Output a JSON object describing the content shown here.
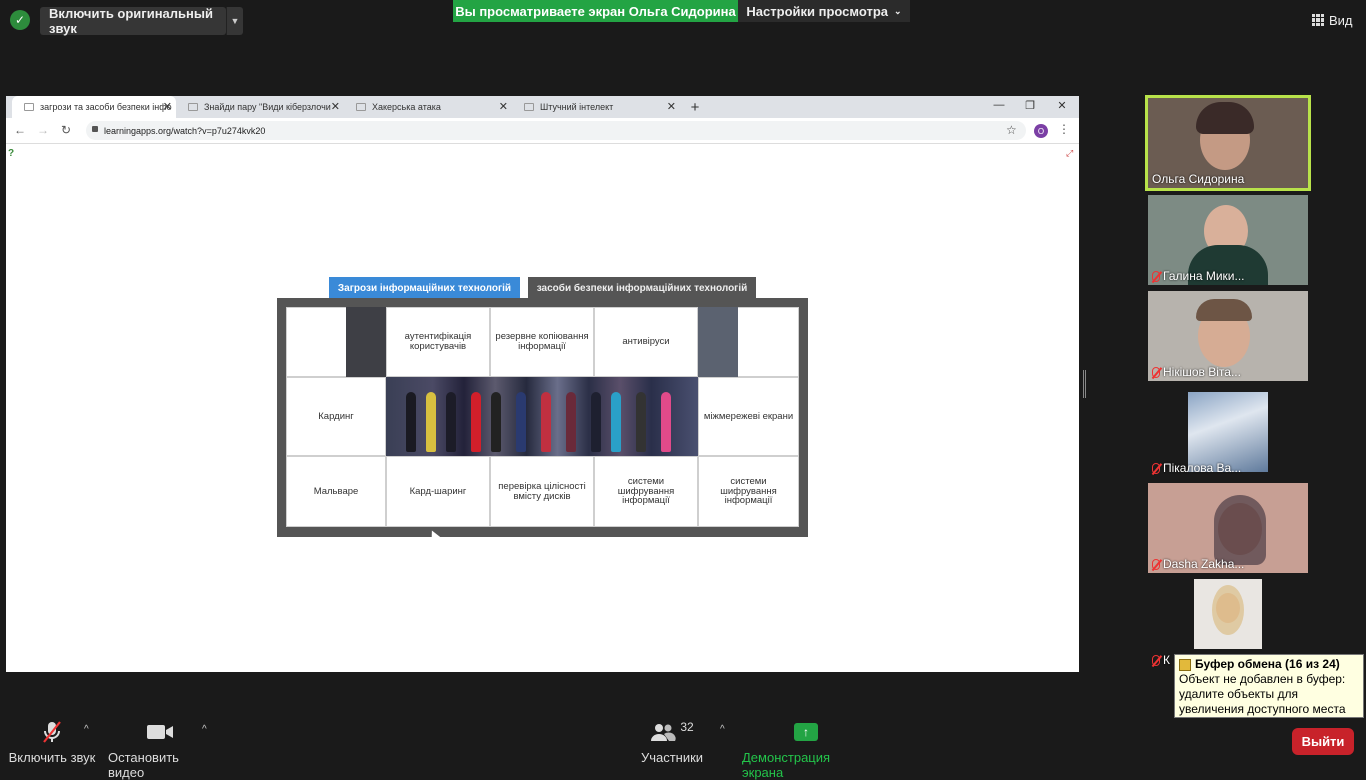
{
  "topbar": {
    "original_sound": "Включить оригинальный звук",
    "viewing_banner": "Вы просматриваете экран Ольга Сидорина",
    "view_settings": "Настройки просмотра",
    "view_button": "Вид"
  },
  "browser": {
    "tabs": [
      {
        "title": "загрози та засоби безпеки інфо"
      },
      {
        "title": "Знайди пару \"Види кіберзлочи"
      },
      {
        "title": "Хакерська атака"
      },
      {
        "title": "Штучний інтелект"
      }
    ],
    "url": "learningapps.org/watch?v=p7u274kvk20",
    "profile_initial": "O"
  },
  "puzzle": {
    "tab_active": "Загрози інформаційних технологій",
    "tab_inactive": "засоби безпеки інформаційних технологій",
    "pieces": {
      "r1c2": "аутентифікація користувачів",
      "r1c3": "резервне копіювання інформації",
      "r1c4": "антивіруси",
      "r2c1": "Кардинг",
      "r2c5": "міжмережеві екрани",
      "r3c1": "Мальваре",
      "r3c2": "Кард-шаринг",
      "r3c3": "перевірка цілісності вмісту дисків",
      "r3c4": "системи шифрування інформації",
      "r3c5": "системи шифрування інформації"
    }
  },
  "participants": [
    {
      "name": "Ольга Сидорина"
    },
    {
      "name": "Галина Мики..."
    },
    {
      "name": "Нікішов Віта..."
    },
    {
      "name": "Пікалова Ва..."
    },
    {
      "name": "Dasha Zakha..."
    },
    {
      "name": "К"
    }
  ],
  "clipboard": {
    "title": "Буфер обмена (16 из 24)",
    "message": "Объект не добавлен в буфер: удалите объекты для увеличения доступного места"
  },
  "bottombar": {
    "unmute": "Включить звук",
    "stop_video": "Остановить видео",
    "participants_label": "Участники",
    "participants_count": "32",
    "share_screen": "Демонстрация экрана",
    "leave": "Выйти"
  }
}
